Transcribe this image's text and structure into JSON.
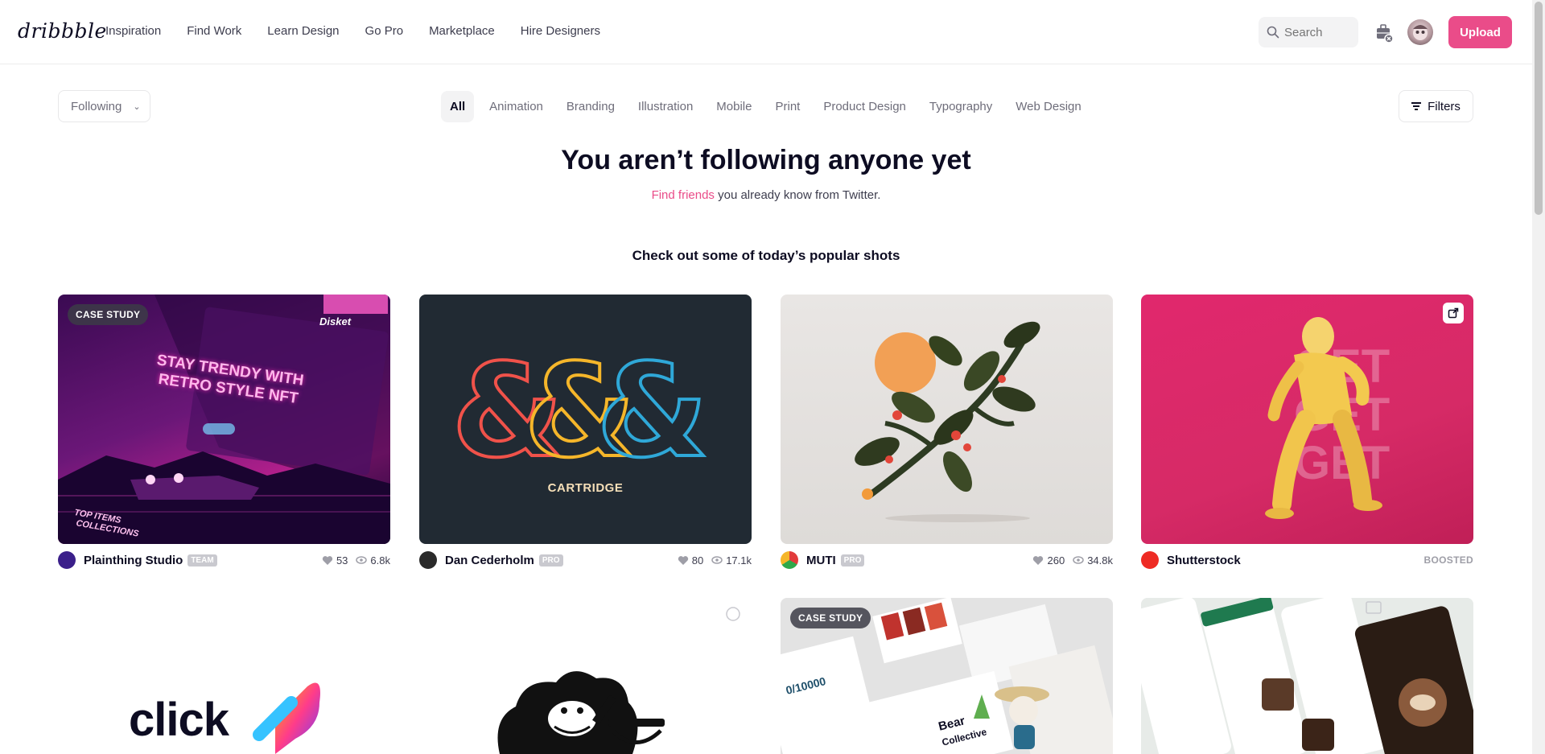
{
  "header": {
    "logo": "dribbble",
    "nav": [
      "Inspiration",
      "Find Work",
      "Learn Design",
      "Go Pro",
      "Marketplace",
      "Hire Designers"
    ],
    "search_placeholder": "Search",
    "upload_label": "Upload"
  },
  "filter_bar": {
    "following_label": "Following",
    "categories": [
      "All",
      "Animation",
      "Branding",
      "Illustration",
      "Mobile",
      "Print",
      "Product Design",
      "Typography",
      "Web Design"
    ],
    "active_category": "All",
    "filters_label": "Filters"
  },
  "empty_state": {
    "title": "You aren’t following anyone yet",
    "link_text": "Find friends",
    "subtitle_rest": " you already know from Twitter.",
    "popular_heading": "Check out some of today’s popular shots"
  },
  "shots": [
    {
      "badge": "CASE STUDY",
      "author": "Plainthing Studio",
      "author_badge": "TEAM",
      "likes": "53",
      "views": "6.8k",
      "art_text": [
        "Disket",
        "STAY TRENDY WITH",
        "RETRO STYLE NFT",
        "TOP ITEMS",
        "COLLECTIONS"
      ]
    },
    {
      "author": "Dan Cederholm",
      "author_badge": "PRO",
      "likes": "80",
      "views": "17.1k",
      "art_text": [
        "CARTRIDGE"
      ]
    },
    {
      "author": "MUTI",
      "author_badge": "PRO",
      "likes": "260",
      "views": "34.8k"
    },
    {
      "author": "Shutterstock",
      "boosted": "BOOSTED",
      "art_text": [
        "GET",
        "GET",
        "GET"
      ]
    },
    {
      "art_text": [
        "click"
      ]
    },
    {},
    {
      "badge": "CASE STUDY",
      "art_text": [
        "Bear",
        "Collective"
      ]
    },
    {}
  ],
  "colors": {
    "brand_pink": "#ea4c89",
    "text_dark": "#0d0c22",
    "text_muted": "#6e6d7a"
  }
}
